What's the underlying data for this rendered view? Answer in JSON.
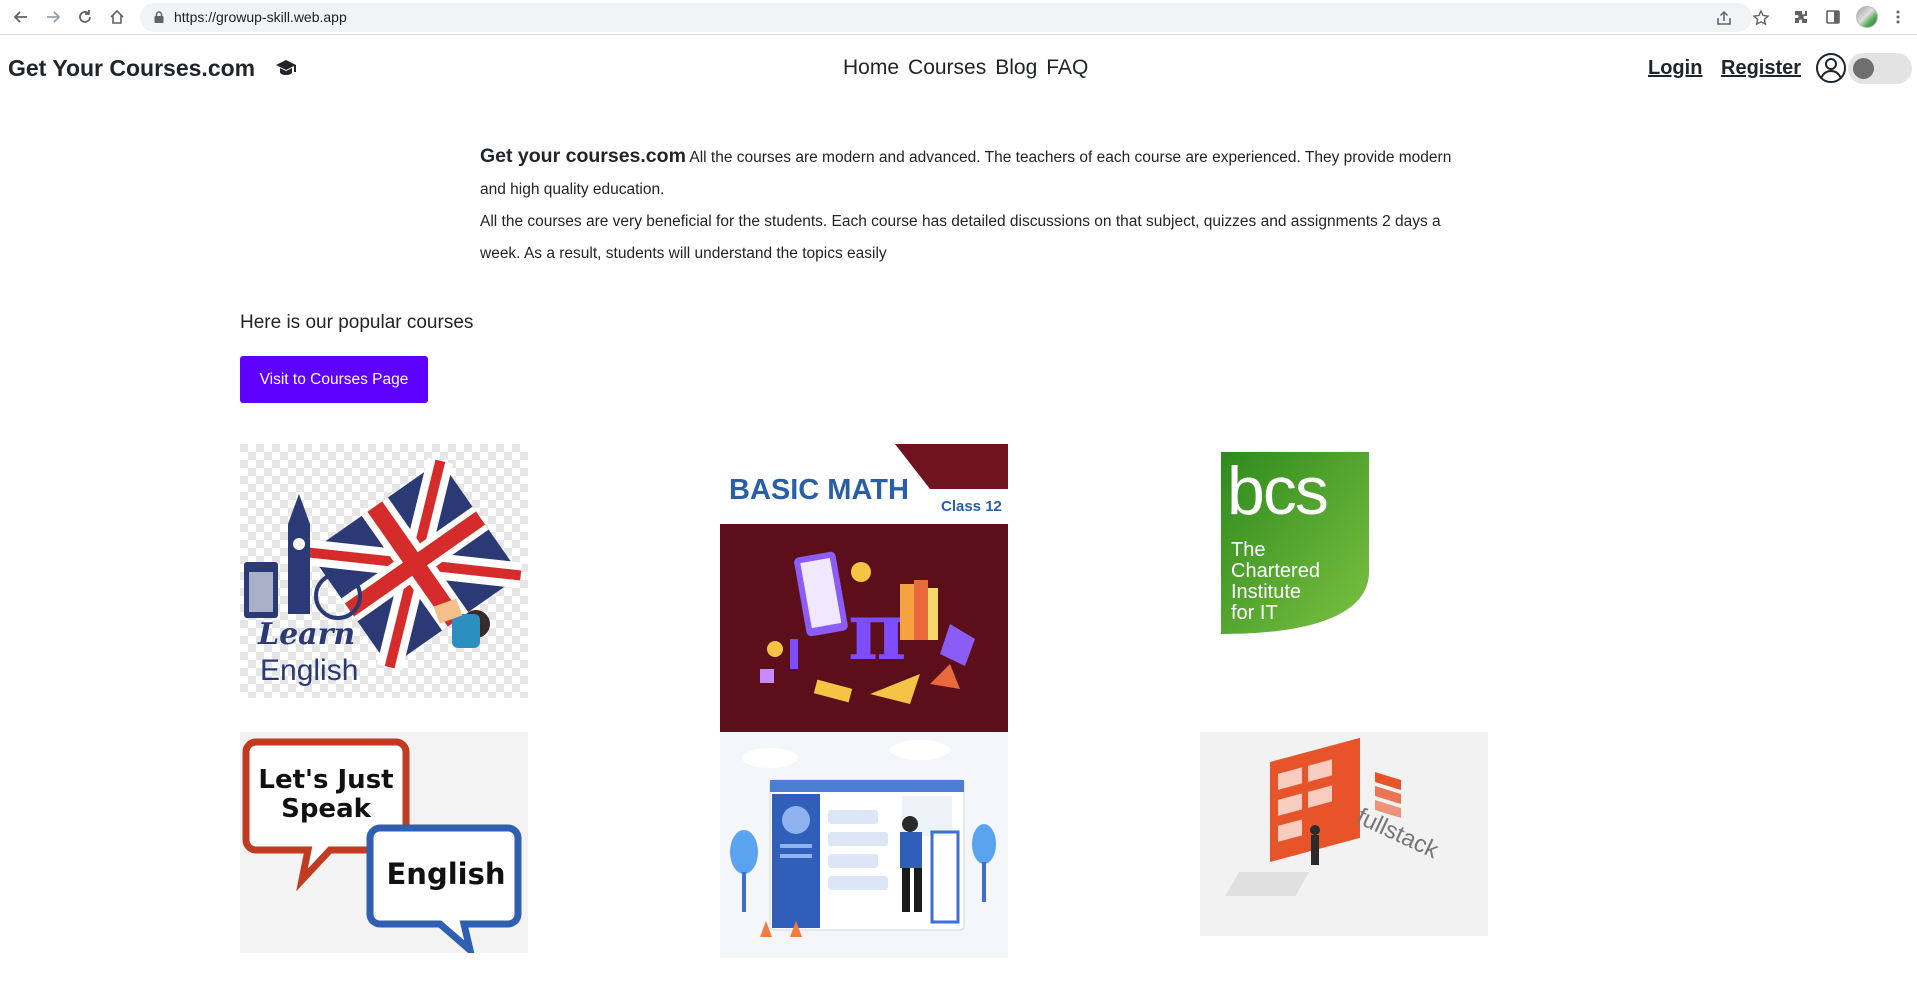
{
  "browser": {
    "url": "https://growup-skill.web.app"
  },
  "site": {
    "brand": "Get Your Courses.com",
    "nav": [
      "Home",
      "Courses",
      "Blog",
      "FAQ"
    ],
    "login": "Login",
    "register": "Register"
  },
  "intro": {
    "brand": "Get your courses.com",
    "p1": "All the courses are modern and advanced. The teachers of each course are experienced. They provide modern and high quality education.",
    "p2": "All the courses are very beneficial for the students. Each course has detailed discussions on that subject, quizzes and assignments 2 days a week. As a result, students will understand the topics easily"
  },
  "popular": {
    "title": "Here is our popular courses",
    "button": "Visit to Courses Page"
  },
  "courses": [
    {
      "art": {
        "line1": "Learn",
        "line2": "English"
      }
    },
    {
      "art": {
        "title": "BASIC MATH",
        "sub": "Class 12"
      }
    },
    {
      "art": {
        "logo": "bcs",
        "line1": "The",
        "line2": "Chartered",
        "line3": "Institute",
        "line4": "for IT"
      }
    },
    {
      "art": {
        "bubble1a": "Let's Just",
        "bubble1b": "Speak",
        "bubble2": "English"
      }
    },
    {
      "art": {}
    },
    {
      "art": {
        "word": "fullstack"
      }
    }
  ],
  "colors": {
    "accent": "#5d00ff",
    "bcs_green": "#3a9a1e",
    "math_bg": "#5c0f1a"
  }
}
